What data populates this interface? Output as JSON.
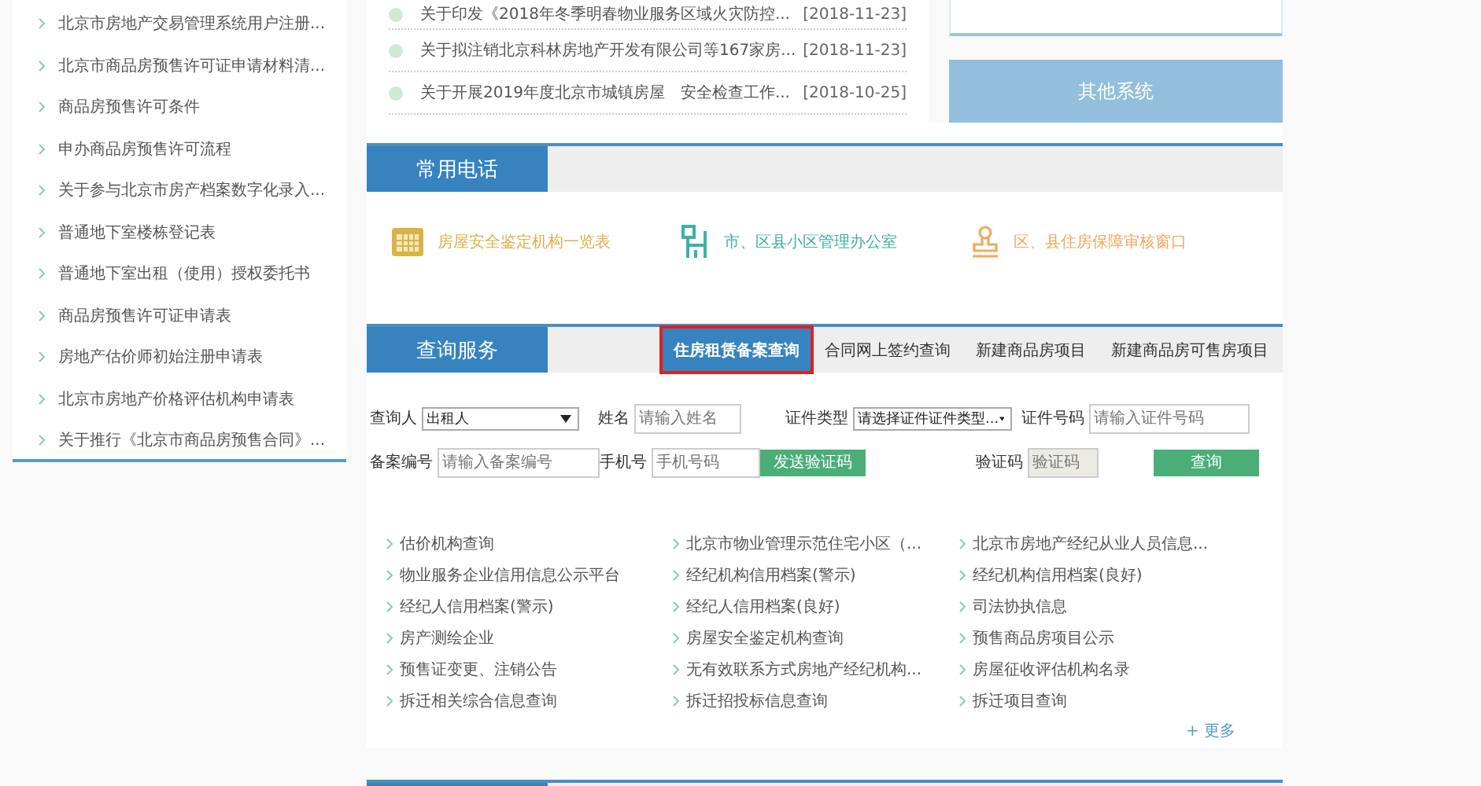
{
  "sidebar": {
    "items": [
      "北京市房地产交易管理系统用户注册...",
      "北京市商品房预售许可证申请材料清...",
      "商品房预售许可条件",
      "申办商品房预售许可流程",
      "关于参与北京市房产档案数字化录入...",
      "普通地下室楼栋登记表",
      "普通地下室出租（使用）授权委托书",
      "商品房预售许可证申请表",
      "房地产估价师初始注册申请表",
      "北京市房地产价格评估机构申请表",
      "关于推行《北京市商品房预售合同》..."
    ]
  },
  "news": [
    {
      "title": "关于印发《2018年冬季明春物业服务区域火灾防控...",
      "date": "[2018-11-23]"
    },
    {
      "title": "关于拟注销北京科林房地产开发有限公司等167家房...",
      "date": "[2018-11-23]"
    },
    {
      "title": "关于开展2019年度北京市城镇房屋　安全检查工作...",
      "date": "[2018-10-25]"
    }
  ],
  "other_systems_button": "其他系统",
  "phones": {
    "title": "常用电话",
    "items": [
      {
        "kind": "calendar",
        "label": "房屋安全鉴定机构一览表",
        "color": "#d9b24a"
      },
      {
        "kind": "building",
        "label": "市、区县小区管理办公室",
        "color": "#3fb0a4"
      },
      {
        "kind": "stamp",
        "label": "区、县住房保障审核窗口",
        "color": "#f0a860"
      }
    ]
  },
  "query": {
    "title": "查询服务",
    "tabs": [
      {
        "label": "住房租赁备案查询",
        "selected": true
      },
      {
        "label": "合同网上签约查询",
        "selected": false
      },
      {
        "label": "新建商品房项目",
        "selected": false
      },
      {
        "label": "新建商品房可售房项目",
        "selected": false
      }
    ],
    "form_rows": [
      [
        {
          "kind": "select",
          "label": "查询人",
          "value": "出租人"
        },
        {
          "kind": "input",
          "label": "姓名",
          "placeholder": "请输入姓名"
        },
        {
          "kind": "select",
          "label": "证件类型",
          "value": "请选择证件证件类型..."
        },
        {
          "kind": "input",
          "label": "证件号码",
          "placeholder": "请输入证件号码"
        }
      ],
      [
        {
          "kind": "input",
          "label": "备案编号",
          "placeholder": "请输入备案编号"
        },
        {
          "kind": "input",
          "label": "手机号",
          "placeholder": "手机号码"
        },
        {
          "kind": "button",
          "label": "发送验证码"
        },
        {
          "kind": "input",
          "label": "验证码",
          "placeholder": "验证码",
          "disabled": true
        },
        {
          "kind": "button",
          "label": "查询"
        }
      ]
    ],
    "links": [
      "估价机构查询",
      "北京市物业管理示范住宅小区（...",
      "北京市房地产经纪从业人员信息...",
      "物业服务企业信用信息公示平台",
      "经纪机构信用档案(警示)",
      "经纪机构信用档案(良好)",
      "经纪人信用档案(警示)",
      "经纪人信用档案(良好)",
      "司法协执信息",
      "房产测绘企业",
      "房屋安全鉴定机构查询",
      "预售商品房项目公示",
      "预售证变更、注销公告",
      "无有效联系方式房地产经纪机构...",
      "房屋征收评估机构名录",
      "拆迁相关综合信息查询",
      "拆迁招投标信息查询",
      "拆迁项目查询"
    ],
    "more": "+ 更多"
  }
}
